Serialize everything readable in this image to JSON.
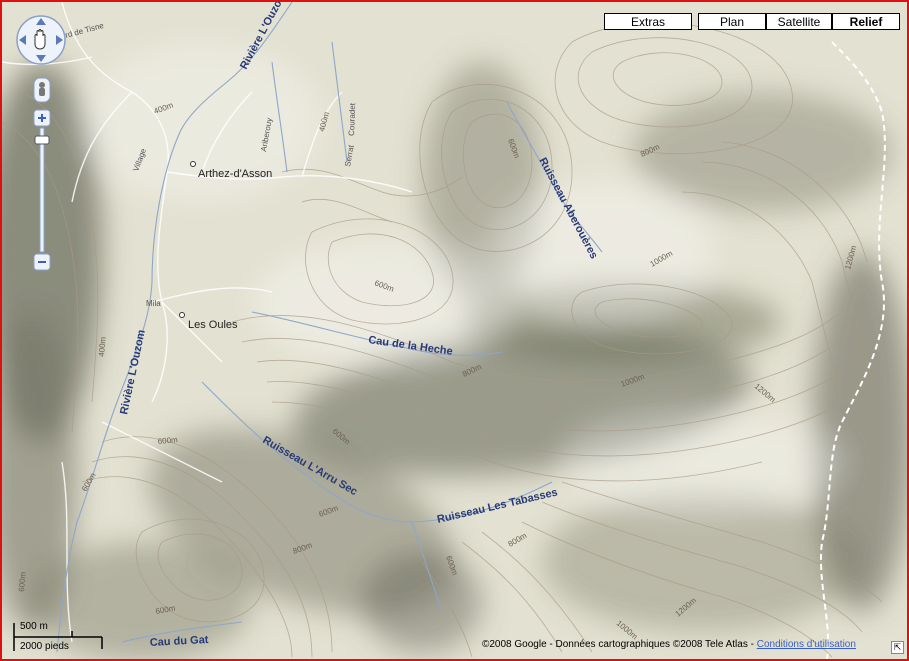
{
  "map_types": {
    "extras": "Extras",
    "plan": "Plan",
    "satellite": "Satellite",
    "relief": "Relief",
    "selected": "Relief"
  },
  "labels": {
    "riviere_ouzom_north": "Rivière L'Ouzom",
    "riviere_ouzom_west": "Rivière L'Ouzom",
    "ruisseau_aberoueres": "Ruisseau Aberouères",
    "cau_de_la_heche": "Cau de la Heche",
    "ruisseau_arru_sec": "Ruisseau L'Arru Sec",
    "ruisseau_tabasses": "Ruisseau Les Tabasses",
    "cau_du_gat": "Cau du Gat",
    "arthez": "Arthez-d'Asson",
    "les_oules": "Les Oules",
    "mila": "Mila",
    "village": "Village",
    "ariberou": "Ariberouy",
    "couradet": "Couradet",
    "serrat": "Serrat",
    "tisne": "rd de Tisne"
  },
  "contour_labels": [
    "400m",
    "400m",
    "600m",
    "800m",
    "1000m",
    "1200m",
    "600m",
    "800m",
    "1000m",
    "1200m",
    "600m",
    "600m",
    "600m",
    "800m",
    "600m",
    "800m",
    "600m",
    "1000m",
    "1200m",
    "400m",
    "600m",
    "600m"
  ],
  "icons": {
    "pan": "pan-control-icon",
    "zoom_in": "plus-icon",
    "zoom_out": "minus-icon",
    "pegman": "pegman-icon",
    "resize": "resize-corner-icon"
  },
  "scale": {
    "metric": "500 m",
    "imperial": "2000 pieds"
  },
  "copyright": {
    "text": "©2008 Google - Données cartographiques ©2008 Tele Atlas - ",
    "terms_link": "Conditions d'utilisation"
  },
  "colors": {
    "frame_border": "#e01010",
    "river_label": "#283a78",
    "water": "#8fa6c9",
    "boundary": "#ffffff"
  }
}
